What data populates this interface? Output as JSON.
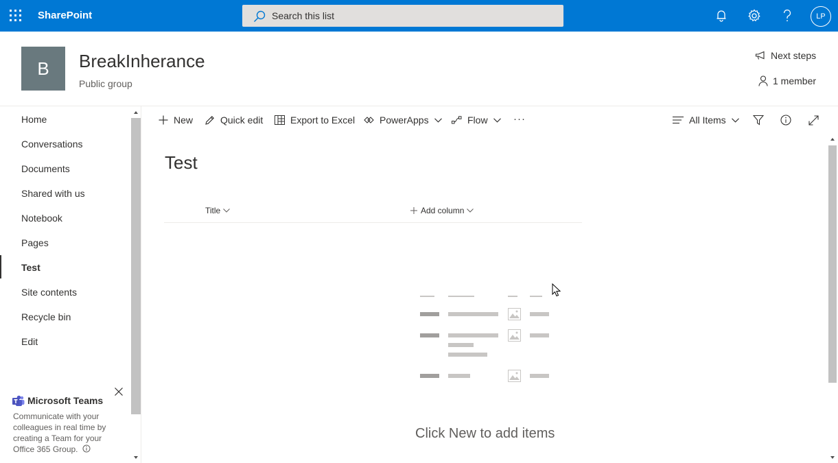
{
  "suitebar": {
    "brand": "SharePoint",
    "search_placeholder": "Search this list",
    "avatar_initials": "LP",
    "color": "#0078d4"
  },
  "site": {
    "logo_letter": "B",
    "title": "BreakInherance",
    "subtitle": "Public group",
    "next_steps": "Next steps",
    "members": "1 member"
  },
  "nav": {
    "items": [
      {
        "label": "Home"
      },
      {
        "label": "Conversations"
      },
      {
        "label": "Documents"
      },
      {
        "label": "Shared with us"
      },
      {
        "label": "Notebook"
      },
      {
        "label": "Pages"
      },
      {
        "label": "Test",
        "active": true
      },
      {
        "label": "Site contents"
      },
      {
        "label": "Recycle bin"
      },
      {
        "label": "Edit"
      }
    ]
  },
  "teams": {
    "title": "Microsoft Teams",
    "text": "Communicate with your colleagues in real time by creating a Team for your Office 365 Group."
  },
  "commandbar": {
    "new": "New",
    "quick_edit": "Quick edit",
    "export": "Export to Excel",
    "powerapps": "PowerApps",
    "flow": "Flow",
    "more": "···",
    "view": "All Items"
  },
  "list": {
    "title": "Test",
    "columns": [
      "Title",
      "Add column"
    ],
    "empty_message": "Click New to add items"
  }
}
